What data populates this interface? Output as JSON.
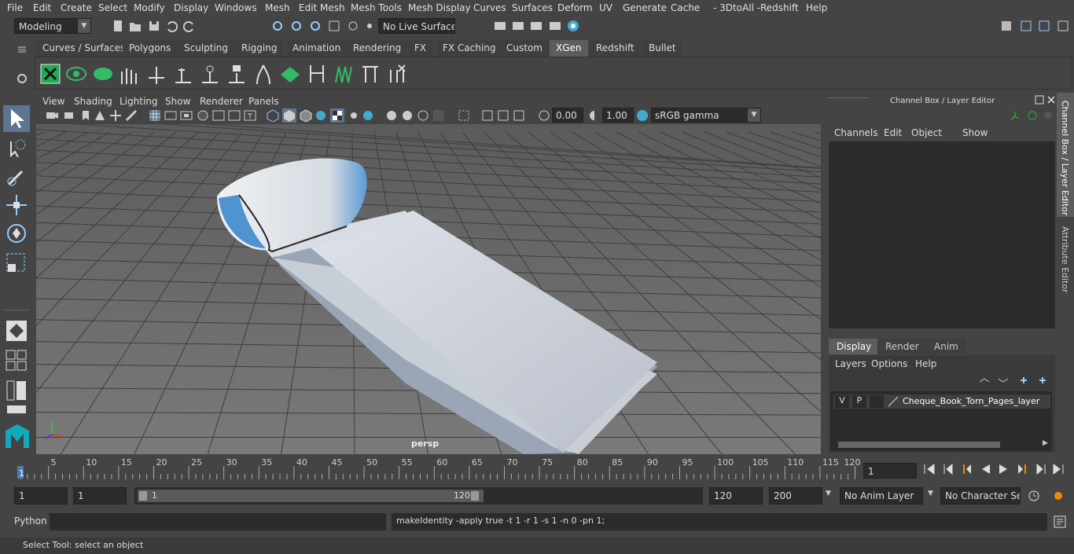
{
  "menu": [
    "File",
    "Edit",
    "Create",
    "Select",
    "Modify",
    "Display",
    "Windows",
    "Mesh",
    "Edit Mesh",
    "Mesh Tools",
    "Mesh Display",
    "Curves",
    "Surfaces",
    "Deform",
    "UV",
    "Generate",
    "Cache",
    "- 3DtoAll -",
    "Redshift",
    "Help"
  ],
  "status": {
    "mode": "Modeling",
    "live_surface": "No Live Surface"
  },
  "shelf_tabs": [
    "Curves / Surfaces",
    "Polygons",
    "Sculpting",
    "Rigging",
    "Animation",
    "Rendering",
    "FX",
    "FX Caching",
    "Custom",
    "XGen",
    "Redshift",
    "Bullet"
  ],
  "active_shelf_tab": "XGen",
  "viewport_menu": [
    "View",
    "Shading",
    "Lighting",
    "Show",
    "Renderer",
    "Panels"
  ],
  "viewport_toolbar": {
    "exposure": "0.00",
    "gamma": "1.00",
    "color_space": "sRGB gamma"
  },
  "viewport_label": "persp",
  "channel_box": {
    "title": "Channel Box / Layer Editor",
    "menu": [
      "Channels",
      "Edit",
      "Object",
      "Show"
    ],
    "layer_tabs": [
      "Display",
      "Render",
      "Anim"
    ],
    "active_layer_tab": "Display",
    "layer_menu": [
      "Layers",
      "Options",
      "Help"
    ],
    "layer": {
      "v": "V",
      "p": "P",
      "name": "Cheque_Book_Torn_Pages_layer"
    }
  },
  "side_tabs": [
    "Channel Box / Layer Editor",
    "Attribute Editor"
  ],
  "timeline": {
    "ticks": [
      "5",
      "10",
      "15",
      "20",
      "25",
      "30",
      "35",
      "40",
      "45",
      "50",
      "55",
      "60",
      "65",
      "70",
      "75",
      "80",
      "85",
      "90",
      "95",
      "100",
      "105",
      "110",
      "115",
      "120"
    ],
    "start_label": "1",
    "current_frame": "1"
  },
  "range": {
    "start": "1",
    "playback_start": "1",
    "slider_start": "1",
    "slider_end": "120",
    "playback_end": "120",
    "end": "200",
    "anim_layer": "No Anim Layer",
    "char_set": "No Character Set"
  },
  "cmd": {
    "lang": "Python",
    "result": "makeIdentity -apply true -t 1 -r 1 -s 1 -n 0 -pn 1;"
  },
  "help_line": "Select Tool: select an object"
}
